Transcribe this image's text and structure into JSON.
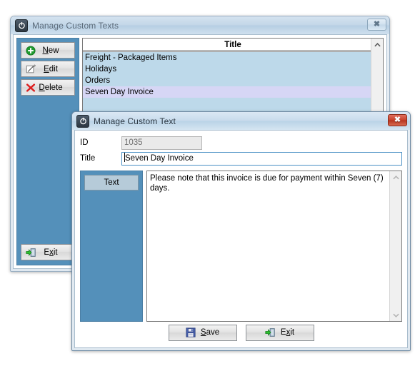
{
  "main_window": {
    "title": "Manage Custom Texts",
    "app_icon": "power-icon",
    "close_button": "close-icon",
    "toolbar": {
      "new": {
        "label_pre": "",
        "label_accel": "N",
        "label_post": "ew",
        "icon": "plus-circle-icon"
      },
      "edit": {
        "label_pre": "",
        "label_accel": "E",
        "label_post": "dit",
        "icon": "pencil-icon"
      },
      "delete": {
        "label_pre": "",
        "label_accel": "D",
        "label_post": "elete",
        "icon": "red-x-icon"
      },
      "exit": {
        "label_pre": "E",
        "label_accel": "x",
        "label_post": "it",
        "icon": "exit-door-icon"
      }
    },
    "list": {
      "column_header": "Title",
      "rows": [
        {
          "title": "Freight - Packaged Items",
          "selected": false
        },
        {
          "title": "Holidays",
          "selected": false
        },
        {
          "title": "Orders",
          "selected": false
        },
        {
          "title": "Seven Day Invoice",
          "selected": true
        }
      ],
      "scrollbar_up": "chevron-up-icon"
    }
  },
  "dialog": {
    "title": "Manage Custom Text",
    "app_icon": "power-icon",
    "close_button": "close-icon",
    "fields": {
      "id_label": "ID",
      "id_value": "1035",
      "title_label": "Title",
      "title_value": "Seven Day Invoice"
    },
    "tab_panel": {
      "text_tab": "Text"
    },
    "editor": {
      "content": "Please note that this invoice is due for payment within Seven (7) days.",
      "scrollbar_up": "chevron-up-icon",
      "scrollbar_down": "chevron-down-icon"
    },
    "footer": {
      "save": {
        "label_pre": "",
        "label_accel": "S",
        "label_post": "ave",
        "icon": "floppy-disk-icon"
      },
      "exit": {
        "label_pre": "E",
        "label_accel": "x",
        "label_post": "it",
        "icon": "exit-door-icon"
      }
    }
  },
  "colors": {
    "panel_blue": "#5490ba",
    "list_row": "#bdd9ea",
    "selected_row": "#d6d6f5",
    "tab_button": "#b6cbd9",
    "active_close": "#c9432c"
  }
}
